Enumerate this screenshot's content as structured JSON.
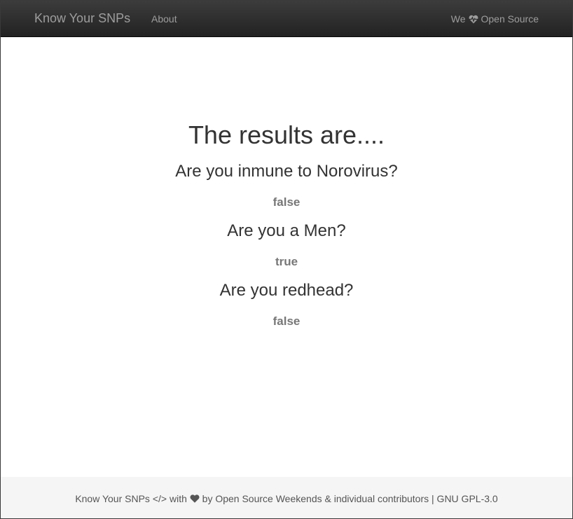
{
  "navbar": {
    "brand": "Know Your SNPs",
    "about": "About",
    "right_prefix": "We",
    "right_suffix": "Open Source"
  },
  "main": {
    "title": "The results are....",
    "results": [
      {
        "question": "Are you inmune to Norovirus?",
        "answer": "false"
      },
      {
        "question": "Are you a Men?",
        "answer": "true"
      },
      {
        "question": "Are you redhead?",
        "answer": "false"
      }
    ]
  },
  "footer": {
    "name": "Know Your SNPs",
    "code_glyph": "</>",
    "with": "with",
    "by_text": "by Open Source Weekends & individual contributors | GNU GPL-3.0"
  },
  "icons": {
    "heart_pulse": "heart-pulse-icon",
    "heart": "heart-icon"
  },
  "colors": {
    "navbar_bg": "#222222",
    "nav_text": "#9d9d9d",
    "heading_text": "#333333",
    "answer_text": "#777777",
    "footer_bg": "#f5f5f5"
  }
}
